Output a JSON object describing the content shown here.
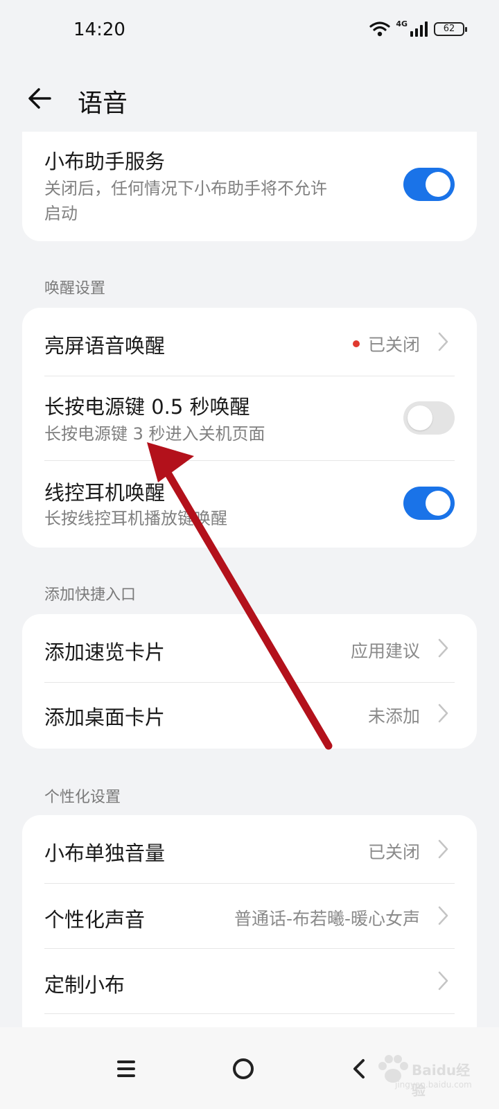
{
  "status": {
    "time": "14:20",
    "network": "4G",
    "battery": "62"
  },
  "header": {
    "title": "语音"
  },
  "service_card": {
    "title": "小布助手服务",
    "subtitle_line1": "关闭后，任何情况下小布助手将不允许",
    "subtitle_line2": "启动",
    "toggle_on": true
  },
  "wake": {
    "section_label": "唤醒设置",
    "items": [
      {
        "title": "亮屏语音唤醒",
        "value": "已关闭",
        "status_dot": "#e0392f"
      },
      {
        "title": "长按电源键 0.5 秒唤醒",
        "subtitle": "长按电源键 3 秒进入关机页面",
        "toggle_on": false
      },
      {
        "title": "线控耳机唤醒",
        "subtitle": "长按线控耳机播放键唤醒",
        "toggle_on": true
      }
    ]
  },
  "shortcuts": {
    "section_label": "添加快捷入口",
    "items": [
      {
        "title": "添加速览卡片",
        "value": "应用建议"
      },
      {
        "title": "添加桌面卡片",
        "value": "未添加"
      }
    ]
  },
  "personal": {
    "section_label": "个性化设置",
    "items": [
      {
        "title": "小布单独音量",
        "value": "已关闭"
      },
      {
        "title": "个性化声音",
        "value": "普通话-布若曦-暖心女声"
      },
      {
        "title": "定制小布",
        "value": ""
      }
    ]
  },
  "watermark": {
    "brand": "Baidu经验",
    "url": "jingyan.baidu.com"
  },
  "colors": {
    "accent": "#1a73e8",
    "annotation_arrow": "#b3111b",
    "background": "#f2f3f5"
  },
  "icons": {
    "back": "back-arrow-icon",
    "wifi": "wifi-icon",
    "signal": "signal-icon",
    "battery": "battery-icon",
    "chevron": "chevron-right-icon",
    "nav_menu": "menu-icon",
    "nav_home": "home-circle-icon",
    "nav_back": "back-chevron-icon"
  }
}
